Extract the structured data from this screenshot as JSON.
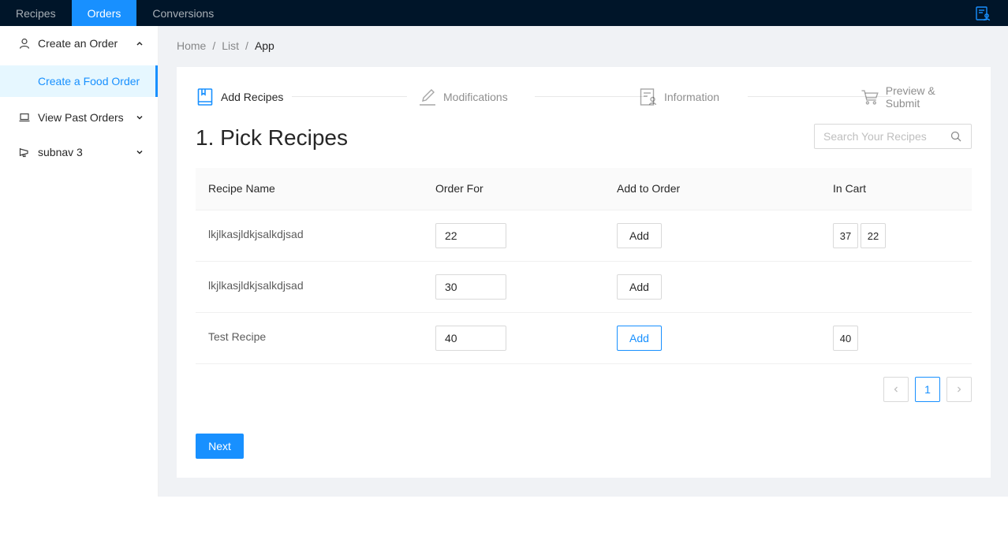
{
  "topnav": {
    "tabs": [
      {
        "label": "Recipes"
      },
      {
        "label": "Orders"
      },
      {
        "label": "Conversions"
      }
    ]
  },
  "sidebar": {
    "items": [
      {
        "label": "Create an Order",
        "icon": "user-icon",
        "expanded": true
      },
      {
        "label": "Create a Food Order",
        "selected": true
      },
      {
        "label": "View Past Orders",
        "icon": "laptop-icon",
        "expanded": false
      },
      {
        "label": "subnav 3",
        "icon": "notification-icon",
        "expanded": false
      }
    ]
  },
  "breadcrumb": {
    "items": [
      "Home",
      "List",
      "App"
    ]
  },
  "steps": [
    {
      "label": "Add Recipes",
      "icon": "book-icon",
      "active": true
    },
    {
      "label": "Modifications",
      "icon": "edit-icon",
      "active": false
    },
    {
      "label": "Information",
      "icon": "profile-icon",
      "active": false
    },
    {
      "label": "Preview & Submit",
      "icon": "cart-icon",
      "active": false
    }
  ],
  "main": {
    "heading": "1. Pick Recipes",
    "search_placeholder": "Search Your Recipes"
  },
  "table": {
    "columns": [
      "Recipe Name",
      "Order For",
      "Add to Order",
      "In Cart"
    ],
    "rows": [
      {
        "name": "lkjlkasjldkjsalkdjsad",
        "order_for": "22",
        "add_label": "Add",
        "in_cart": [
          "37",
          "22"
        ]
      },
      {
        "name": "lkjlkasjldkjsalkdjsad",
        "order_for": "30",
        "add_label": "Add",
        "in_cart": []
      },
      {
        "name": "Test Recipe",
        "order_for": "40",
        "add_label": "Add",
        "in_cart": [
          "40"
        ]
      }
    ]
  },
  "pagination": {
    "current_page": "1"
  },
  "footer": {
    "next_label": "Next"
  },
  "colors": {
    "primary": "#1890ff",
    "header_bg": "#001529",
    "content_bg": "#f0f2f5"
  }
}
